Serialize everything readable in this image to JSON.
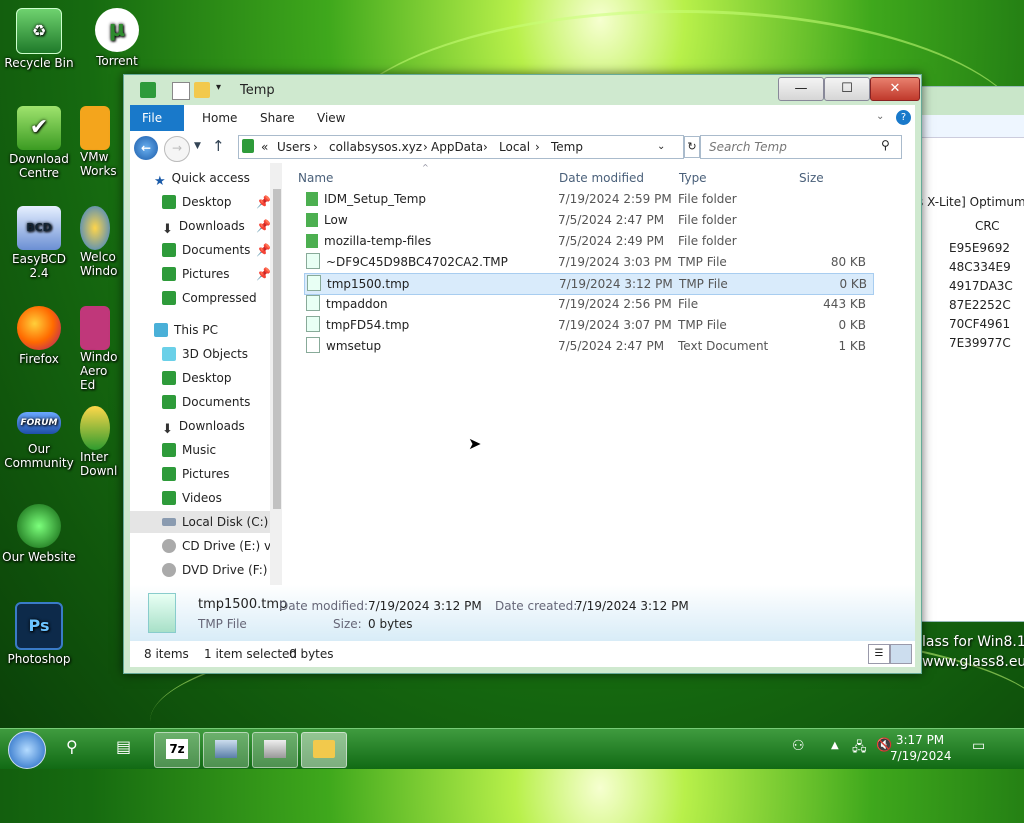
{
  "desktop": {
    "icons": [
      {
        "label": "Recycle Bin"
      },
      {
        "label": "Torrent"
      },
      {
        "label": "Download Centre"
      },
      {
        "label": "VMw Works"
      },
      {
        "label": "EasyBCD 2.4"
      },
      {
        "label": "Welco Windo"
      },
      {
        "label": "Firefox"
      },
      {
        "label": "Windo Aero Ed"
      },
      {
        "label": "Our Community"
      },
      {
        "label": "Inter Downl"
      },
      {
        "label": "Our Website"
      },
      {
        "label": "Photoshop"
      }
    ],
    "forum_badge": "FORUM",
    "watermark_line1": "lass for Win8.1",
    "watermark_line2": "www.glass8.eu"
  },
  "background_window": {
    "header_text": "s X-Lite] Optimum T",
    "column_header": "CRC",
    "crc_values": [
      "E95E9692",
      "48C334E9",
      "4917DA3C",
      "87E2252C",
      "70CF4961",
      "7E39977C"
    ]
  },
  "explorer": {
    "title": "Temp",
    "caption_buttons": {
      "minimize": "—",
      "maximize": "☐",
      "close": "✕"
    },
    "ribbon_tabs": [
      "File",
      "Home",
      "Share",
      "View"
    ],
    "address": {
      "overflow": "«",
      "crumbs": [
        "Users",
        "collabsysos.xyz",
        "AppData",
        "Local",
        "Temp"
      ]
    },
    "search_placeholder": "Search Temp",
    "nav": {
      "quick_access": "Quick access",
      "quick_items": [
        {
          "label": "Desktop",
          "pinned": true
        },
        {
          "label": "Downloads",
          "pinned": true
        },
        {
          "label": "Documents",
          "pinned": true
        },
        {
          "label": "Pictures",
          "pinned": true
        },
        {
          "label": "Compressed",
          "pinned": false
        }
      ],
      "this_pc": "This PC",
      "pc_items": [
        {
          "label": "3D Objects"
        },
        {
          "label": "Desktop"
        },
        {
          "label": "Documents"
        },
        {
          "label": "Downloads"
        },
        {
          "label": "Music"
        },
        {
          "label": "Pictures"
        },
        {
          "label": "Videos"
        },
        {
          "label": "Local Disk (C:)"
        },
        {
          "label": "CD Drive (E:) virt"
        },
        {
          "label": "DVD Drive (F:) H"
        }
      ]
    },
    "columns": {
      "name": "Name",
      "date": "Date modified",
      "type": "Type",
      "size": "Size"
    },
    "files": [
      {
        "name": "IDM_Setup_Temp",
        "date": "7/19/2024 2:59 PM",
        "type": "File folder",
        "size": "",
        "kind": "folder"
      },
      {
        "name": "Low",
        "date": "7/5/2024 2:47 PM",
        "type": "File folder",
        "size": "",
        "kind": "folder"
      },
      {
        "name": "mozilla-temp-files",
        "date": "7/5/2024 2:49 PM",
        "type": "File folder",
        "size": "",
        "kind": "folder"
      },
      {
        "name": "~DF9C45D98BC4702CA2.TMP",
        "date": "7/19/2024 3:03 PM",
        "type": "TMP File",
        "size": "80 KB",
        "kind": "file"
      },
      {
        "name": "tmp1500.tmp",
        "date": "7/19/2024 3:12 PM",
        "type": "TMP File",
        "size": "0 KB",
        "kind": "file",
        "selected": true
      },
      {
        "name": "tmpaddon",
        "date": "7/19/2024 2:56 PM",
        "type": "File",
        "size": "443 KB",
        "kind": "file"
      },
      {
        "name": "tmpFD54.tmp",
        "date": "7/19/2024 3:07 PM",
        "type": "TMP File",
        "size": "0 KB",
        "kind": "file"
      },
      {
        "name": "wmsetup",
        "date": "7/5/2024 2:47 PM",
        "type": "Text Document",
        "size": "1 KB",
        "kind": "text"
      }
    ],
    "details": {
      "name": "tmp1500.tmp",
      "type": "TMP File",
      "modified_label": "Date modified:",
      "modified": "7/19/2024 3:12 PM",
      "created_label": "Date created:",
      "created": "7/19/2024 3:12 PM",
      "size_label": "Size:",
      "size": "0 bytes"
    },
    "status": {
      "items": "8 items",
      "selection": "1 item selected",
      "bytes": "0 bytes"
    }
  },
  "taskbar": {
    "time": "3:17 PM",
    "date": "7/19/2024",
    "seven_zip_label": "7z"
  },
  "colors": {
    "accent": "#1979ca",
    "selection": "#d9ebfb",
    "folder": "#4caf50"
  }
}
